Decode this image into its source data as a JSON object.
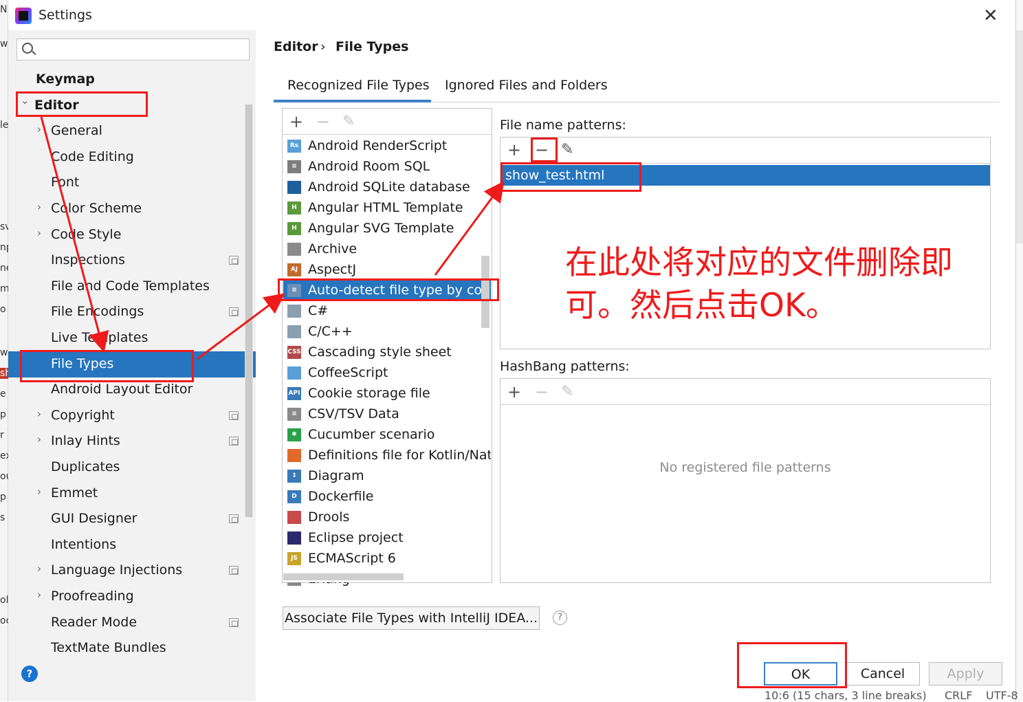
{
  "window": {
    "title": "Settings",
    "close_glyph": "✕"
  },
  "background_window": {
    "left_edge_glyphs": [
      "N",
      "w",
      "le",
      "sv",
      "np",
      "ne",
      "m",
      "o",
      "w",
      "sh",
      "e",
      "p",
      "r",
      "ex",
      "ou",
      "p",
      "s",
      "ol",
      "oc"
    ],
    "status_text": "10:6 (15 chars, 3 line breaks)",
    "status_right": [
      "CRLF",
      "UTF-8"
    ]
  },
  "sidebar": {
    "search": {
      "value": "",
      "placeholder": ""
    },
    "items": [
      {
        "label": "Keymap",
        "bold": true,
        "chevron": ""
      },
      {
        "label": "Editor",
        "bold": true,
        "chevron": "⌄"
      },
      {
        "label": "General",
        "chevron": "›"
      },
      {
        "label": "Code Editing",
        "chevron": ""
      },
      {
        "label": "Font",
        "chevron": ""
      },
      {
        "label": "Color Scheme",
        "chevron": "›"
      },
      {
        "label": "Code Style",
        "chevron": "›"
      },
      {
        "label": "Inspections",
        "chevron": "",
        "project": true
      },
      {
        "label": "File and Code Templates",
        "chevron": ""
      },
      {
        "label": "File Encodings",
        "chevron": "",
        "project": true
      },
      {
        "label": "Live Templates",
        "chevron": ""
      },
      {
        "label": "File Types",
        "chevron": "",
        "selected": true
      },
      {
        "label": "Android Layout Editor",
        "chevron": ""
      },
      {
        "label": "Copyright",
        "chevron": "›",
        "project": true
      },
      {
        "label": "Inlay Hints",
        "chevron": "›",
        "project": true
      },
      {
        "label": "Duplicates",
        "chevron": ""
      },
      {
        "label": "Emmet",
        "chevron": "›"
      },
      {
        "label": "GUI Designer",
        "chevron": "",
        "project": true
      },
      {
        "label": "Intentions",
        "chevron": ""
      },
      {
        "label": "Language Injections",
        "chevron": "›",
        "project": true
      },
      {
        "label": "Proofreading",
        "chevron": "›"
      },
      {
        "label": "Reader Mode",
        "chevron": "",
        "project": true
      },
      {
        "label": "TextMate Bundles",
        "chevron": ""
      }
    ]
  },
  "breadcrumb": {
    "parent": "Editor",
    "separator": "›",
    "current": "File Types"
  },
  "tabs": [
    {
      "label": "Recognized File Types",
      "active": true
    },
    {
      "label": "Ignored Files and Folders",
      "active": false
    }
  ],
  "toolbar_glyphs": {
    "add": "+",
    "remove": "−",
    "edit": "✎"
  },
  "file_types": {
    "selected_index": 7,
    "items": [
      {
        "label": "Android RenderScript",
        "icon": "renderscript-icon",
        "glyph": "Rs",
        "color": "#5aa0d8"
      },
      {
        "label": "Android Room SQL",
        "icon": "sql-icon",
        "glyph": "≡",
        "color": "#7d7d7d"
      },
      {
        "label": "Android SQLite database",
        "icon": "sqlite-icon",
        "glyph": "",
        "color": "#1e5f9e"
      },
      {
        "label": "Angular HTML Template",
        "icon": "angular-html-icon",
        "glyph": "H",
        "color": "#5a9a3c"
      },
      {
        "label": "Angular SVG Template",
        "icon": "angular-svg-icon",
        "glyph": "H",
        "color": "#5a9a3c"
      },
      {
        "label": "Archive",
        "icon": "archive-icon",
        "glyph": "",
        "color": "#8a8a8a"
      },
      {
        "label": "AspectJ",
        "icon": "aspectj-icon",
        "glyph": "AJ",
        "color": "#c06a2c"
      },
      {
        "label": "Auto-detect file type by content",
        "icon": "text-file-icon",
        "glyph": "≡",
        "color": "#6c8fb8"
      },
      {
        "label": "C#",
        "icon": "csharp-icon",
        "glyph": "",
        "color": "#8a9fb0"
      },
      {
        "label": "C/C++",
        "icon": "cpp-icon",
        "glyph": "",
        "color": "#8a9fb0"
      },
      {
        "label": "Cascading style sheet",
        "icon": "css-icon",
        "glyph": "CSS",
        "color": "#b24a4a"
      },
      {
        "label": "CoffeeScript",
        "icon": "coffeescript-icon",
        "glyph": "",
        "color": "#5aa0d8"
      },
      {
        "label": "Cookie storage file",
        "icon": "api-icon",
        "glyph": "API",
        "color": "#3a7ab8"
      },
      {
        "label": "CSV/TSV Data",
        "icon": "csv-icon",
        "glyph": "≡",
        "color": "#8a8a8a"
      },
      {
        "label": "Cucumber scenario",
        "icon": "cucumber-icon",
        "glyph": "✱",
        "color": "#2aa04a"
      },
      {
        "label": "Definitions file for Kotlin/Native C interop",
        "icon": "kotlin-icon",
        "glyph": "",
        "color": "#e06a2a"
      },
      {
        "label": "Diagram",
        "icon": "diagram-icon",
        "glyph": "↕",
        "color": "#3a7ab8"
      },
      {
        "label": "Dockerfile",
        "icon": "docker-icon",
        "glyph": "D",
        "color": "#3a7ab8"
      },
      {
        "label": "Drools",
        "icon": "drools-icon",
        "glyph": "",
        "color": "#c84a4a"
      },
      {
        "label": "Eclipse project",
        "icon": "eclipse-icon",
        "glyph": "",
        "color": "#2c2a6e"
      },
      {
        "label": "ECMAScript 6",
        "icon": "ecmascript-icon",
        "glyph": "JS",
        "color": "#c8a42a"
      },
      {
        "label": "Erlang",
        "icon": "erlang-icon",
        "glyph": "",
        "color": "#8a8a8a"
      }
    ]
  },
  "file_name_patterns": {
    "label": "File name patterns:",
    "items": [
      "show_test.html"
    ]
  },
  "hashbang_patterns": {
    "label": "HashBang patterns:",
    "empty_message": "No registered file patterns"
  },
  "associate_button": "Associate File Types with IntelliJ IDEA...",
  "help_glyph": "?",
  "dialog_buttons": {
    "ok": "OK",
    "cancel": "Cancel",
    "apply": "Apply"
  },
  "annotation": {
    "text": "在此处将对应的文件删除即可。然后点击OK。",
    "color": "#ee1b1b"
  }
}
